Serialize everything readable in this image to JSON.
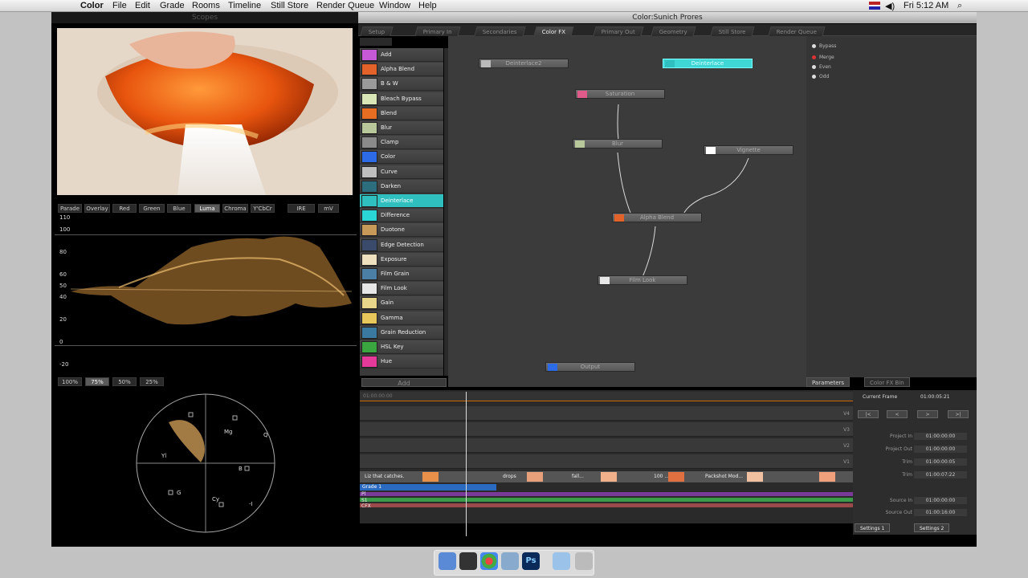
{
  "menubar": {
    "app": "Color",
    "items": [
      "File",
      "Edit",
      "Grade",
      "Rooms",
      "Timeline",
      "Still Store",
      "Render Queue",
      "Window",
      "Help"
    ],
    "clock": "Fri 5:12 AM"
  },
  "left_window": {
    "title": "Scopes"
  },
  "right_window": {
    "title": "Color:Sunich Prores"
  },
  "scope_buttons": [
    "Parade",
    "Overlay",
    "Red",
    "Green",
    "Blue",
    "Luma",
    "Chroma",
    "Y'CbCr"
  ],
  "scope_units": [
    "IRE",
    "mV"
  ],
  "waveform_labels": [
    "110",
    "100",
    "80",
    "60",
    "50",
    "40",
    "20",
    "0",
    "-20"
  ],
  "zoom_buttons": [
    "100%",
    "75%",
    "50%",
    "25%"
  ],
  "vectorscope_labels": {
    "mg": "Mg",
    "r": "R",
    "yl": "Yl",
    "b": "B",
    "g": "G",
    "cy": "Cy",
    "q": "Q",
    "i": "-I"
  },
  "tabs": [
    "Setup",
    "Primary In",
    "Secondaries",
    "Color FX",
    "Primary Out",
    "Geometry",
    "Still Store",
    "Render Queue"
  ],
  "fx_items": [
    {
      "label": "Add",
      "color": "#c65ad6"
    },
    {
      "label": "Alpha Blend",
      "color": "#e2622a"
    },
    {
      "label": "B & W",
      "color": "#9a9a9a"
    },
    {
      "label": "Bleach Bypass",
      "color": "#d9e6b5"
    },
    {
      "label": "Blend",
      "color": "#e76d22"
    },
    {
      "label": "Blur",
      "color": "#b9c89a"
    },
    {
      "label": "Clamp",
      "color": "#8a8a8a"
    },
    {
      "label": "Color",
      "color": "#2d6ae6"
    },
    {
      "label": "Curve",
      "color": "#bfbfbf"
    },
    {
      "label": "Darken",
      "color": "#2c6e7e"
    },
    {
      "label": "Deinterlace",
      "color": "#2fbfbf"
    },
    {
      "label": "Difference",
      "color": "#2ad6d6"
    },
    {
      "label": "Duotone",
      "color": "#c79a5a"
    },
    {
      "label": "Edge Detection",
      "color": "#3a4a6a"
    },
    {
      "label": "Exposure",
      "color": "#efe0c0"
    },
    {
      "label": "Film Grain",
      "color": "#4b7fa6"
    },
    {
      "label": "Film Look",
      "color": "#e7e7e7"
    },
    {
      "label": "Gain",
      "color": "#e8d58a"
    },
    {
      "label": "Gamma",
      "color": "#e8c85a"
    },
    {
      "label": "Grain Reduction",
      "color": "#3a7aa0"
    },
    {
      "label": "HSL Key",
      "color": "#3aa640"
    },
    {
      "label": "Hue",
      "color": "#e63a9a"
    }
  ],
  "add_button": "Add",
  "nodes": [
    {
      "id": "deinterlace2",
      "label": "Deinterlace2",
      "color": "#bbbbbb"
    },
    {
      "id": "deinterlace",
      "label": "Deinterlace",
      "color": "#2fbfbf"
    },
    {
      "id": "saturation",
      "label": "Saturation",
      "color": "#e05a8a"
    },
    {
      "id": "blur",
      "label": "Blur",
      "color": "#b9c89a"
    },
    {
      "id": "vignette",
      "label": "Vignette",
      "color": "#ffffff"
    },
    {
      "id": "alpha-blend",
      "label": "Alpha Blend",
      "color": "#e2622a"
    },
    {
      "id": "film-look",
      "label": "Film Look",
      "color": "#e7e7e7"
    },
    {
      "id": "output",
      "label": "Output",
      "color": "#2d6ae6"
    }
  ],
  "params": {
    "options": [
      "Bypass",
      "Merge",
      "Even",
      "Odd"
    ],
    "selected": "Merge"
  },
  "right_tabs": [
    "Parameters",
    "Color FX Bin"
  ],
  "timeline": {
    "timecode": "01:00:00:00",
    "tracks": [
      "V4",
      "V3",
      "V2",
      "V1"
    ],
    "clips": [
      "Liz that catches.",
      "drops",
      "fall...",
      "100 ...",
      "Packshot Mod..."
    ],
    "grade": "Grade 1",
    "row_labels": [
      "Pl",
      "S1",
      "CFX"
    ]
  },
  "transport": {
    "current_frame_label": "Current Frame",
    "current_frame": "01:00:05:21",
    "buttons": [
      "|<",
      "<",
      ">",
      ">|"
    ],
    "fields": [
      {
        "label": "Project In",
        "value": "01:00:00:00"
      },
      {
        "label": "Project Out",
        "value": "01:00:00:00"
      },
      {
        "label": "Trim",
        "value": "01:00:00:05"
      },
      {
        "label": "Trim",
        "value": "01:00:07:22"
      },
      {
        "label": "Source In",
        "value": "01:00:00:00"
      },
      {
        "label": "Source Out",
        "value": "01:00:16:00"
      }
    ],
    "settings": [
      "Settings 1",
      "Settings 2"
    ]
  }
}
